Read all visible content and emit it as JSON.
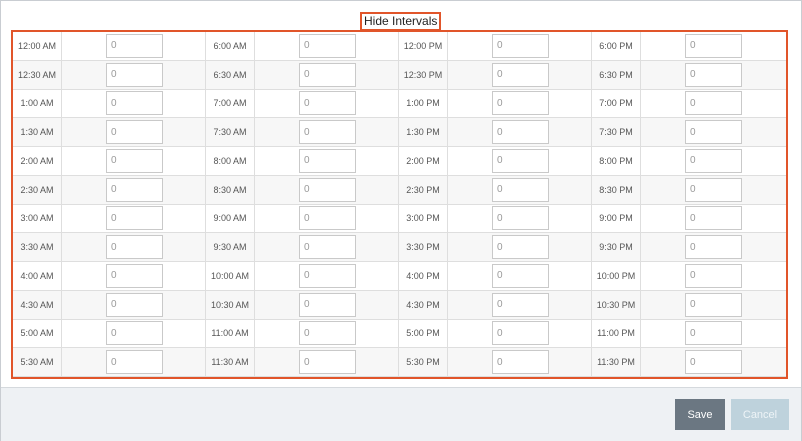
{
  "header": {
    "hide_intervals_label": "Hide Intervals"
  },
  "schedule": {
    "input_value": "0",
    "columns": [
      [
        "12:00 AM",
        "12:30 AM",
        "1:00 AM",
        "1:30 AM",
        "2:00 AM",
        "2:30 AM",
        "3:00 AM",
        "3:30 AM",
        "4:00 AM",
        "4:30 AM",
        "5:00 AM",
        "5:30 AM"
      ],
      [
        "6:00 AM",
        "6:30 AM",
        "7:00 AM",
        "7:30 AM",
        "8:00 AM",
        "8:30 AM",
        "9:00 AM",
        "9:30 AM",
        "10:00 AM",
        "10:30 AM",
        "11:00 AM",
        "11:30 AM"
      ],
      [
        "12:00 PM",
        "12:30 PM",
        "1:00 PM",
        "1:30 PM",
        "2:00 PM",
        "2:30 PM",
        "3:00 PM",
        "3:30 PM",
        "4:00 PM",
        "4:30 PM",
        "5:00 PM",
        "5:30 PM"
      ],
      [
        "6:00 PM",
        "6:30 PM",
        "7:00 PM",
        "7:30 PM",
        "8:00 PM",
        "8:30 PM",
        "9:00 PM",
        "9:30 PM",
        "10:00 PM",
        "10:30 PM",
        "11:00 PM",
        "11:30 PM"
      ]
    ]
  },
  "footer": {
    "save_label": "Save",
    "cancel_label": "Cancel"
  },
  "colors": {
    "highlight": "#e1552a",
    "save_button": "#6b7782",
    "cancel_button": "#bed2dc",
    "footer_background": "#eef1f4"
  }
}
